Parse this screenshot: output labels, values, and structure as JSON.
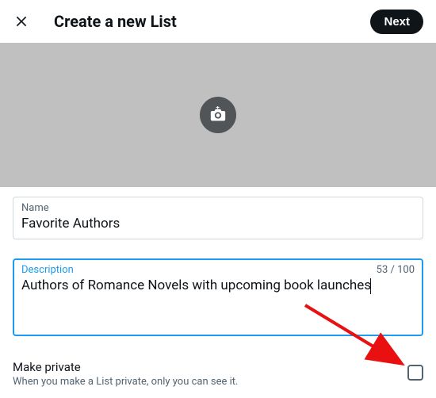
{
  "header": {
    "title": "Create a new List",
    "next_label": "Next"
  },
  "name_field": {
    "label": "Name",
    "value": "Favorite Authors"
  },
  "description_field": {
    "label": "Description",
    "value": "Authors of Romance Novels with upcoming book launches",
    "count": "53 / 100"
  },
  "private": {
    "title": "Make private",
    "subtitle": "When you make a List private, only you can see it."
  }
}
